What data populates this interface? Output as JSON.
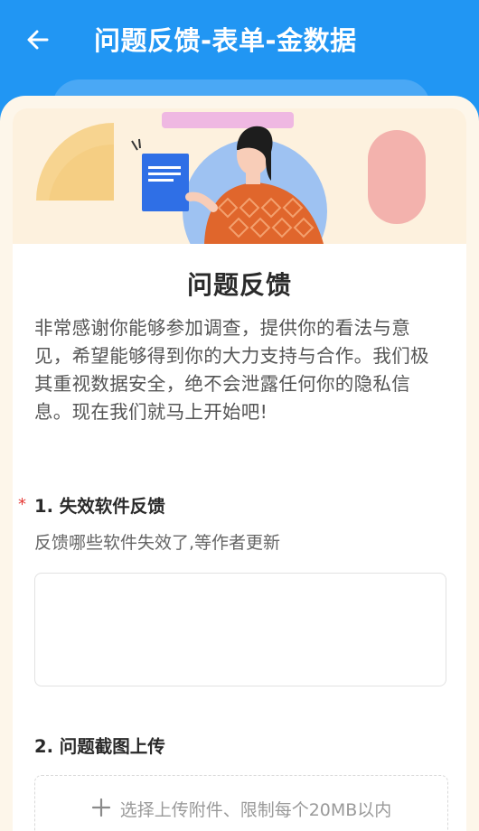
{
  "header": {
    "title": "问题反馈-表单-金数据",
    "back_icon": "arrow-left-icon"
  },
  "colors": {
    "header_bg": "#2196f3",
    "sheet_bg": "#fdf6ea",
    "required": "#e53935"
  },
  "survey": {
    "title": "问题反馈",
    "intro": "非常感谢你能够参加调查，提供你的看法与意见，希望能够得到你的大力支持与合作。我们极其重视数据安全，绝不会泄露任何你的隐私信息。现在我们就马上开始吧!"
  },
  "questions": [
    {
      "required_mark": "*",
      "title": "1. 失效软件反馈",
      "description": "反馈哪些软件失效了,等作者更新",
      "value": ""
    },
    {
      "title": "2. 问题截图上传",
      "upload_icon": "plus-icon",
      "upload_label": "选择上传附件、限制每个20MB以内"
    }
  ]
}
